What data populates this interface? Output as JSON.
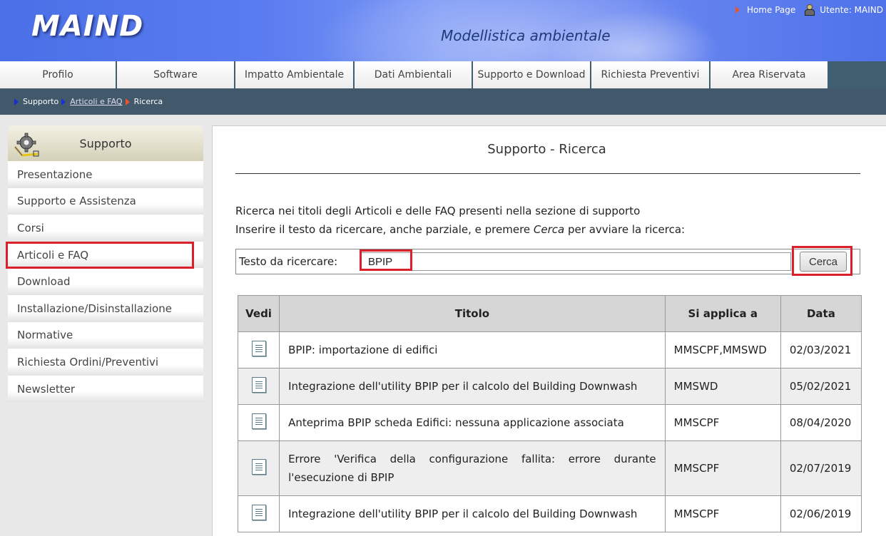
{
  "header": {
    "logo": "MAIND",
    "tagline": "Modellistica ambientale",
    "home_link": "Home Page",
    "user_label": "Utente: MAIND"
  },
  "nav": [
    {
      "label": "Profilo"
    },
    {
      "label": "Software"
    },
    {
      "label": "Impatto Ambientale"
    },
    {
      "label": "Dati Ambientali"
    },
    {
      "label": "Supporto e Download"
    },
    {
      "label": "Richiesta Preventivi"
    },
    {
      "label": "Area Riservata"
    }
  ],
  "breadcrumb": {
    "item1": "Supporto",
    "item2": "Articoli e FAQ",
    "item3": "Ricerca"
  },
  "sidebar": {
    "title": "Supporto",
    "items": [
      {
        "label": "Presentazione"
      },
      {
        "label": "Supporto e Assistenza"
      },
      {
        "label": "Corsi"
      },
      {
        "label": "Articoli e FAQ"
      },
      {
        "label": "Download"
      },
      {
        "label": "Installazione/Disinstallazione"
      },
      {
        "label": "Normative"
      },
      {
        "label": "Richiesta Ordini/Preventivi"
      },
      {
        "label": "Newsletter"
      }
    ]
  },
  "main": {
    "title": "Supporto - Ricerca",
    "intro_line1": "Ricerca nei titoli degli Articoli e delle FAQ presenti nella sezione di supporto",
    "intro_line2_pre": "Inserire il testo da ricercare, anche parziale, e premere ",
    "intro_line2_em": "Cerca",
    "intro_line2_post": " per avviare la ricerca:",
    "search_label": "Testo da ricercare:",
    "search_value": "BPIP",
    "search_button": "Cerca"
  },
  "table": {
    "headers": {
      "vedi": "Vedi",
      "titolo": "Titolo",
      "applica": "Si applica a",
      "data": "Data"
    },
    "rows": [
      {
        "titolo": "BPIP: importazione di edifici",
        "applica": "MMSCPF,MMSWD",
        "data": "02/03/2021"
      },
      {
        "titolo": "Integrazione dell'utility BPIP per il calcolo del Building Downwash",
        "applica": "MMSWD",
        "data": "05/02/2021"
      },
      {
        "titolo": "Anteprima BPIP scheda Edifici: nessuna applicazione associata",
        "applica": "MMSCPF",
        "data": "08/04/2020"
      },
      {
        "titolo": "Errore 'Verifica della configurazione fallita: errore durante l'esecuzione di BPIP",
        "applica": "MMSCPF",
        "data": "02/07/2019"
      },
      {
        "titolo": "Integrazione dell'utility BPIP per il calcolo del Building Downwash",
        "applica": "MMSCPF",
        "data": "02/06/2019"
      }
    ]
  },
  "colors": {
    "highlight": "#d9202b",
    "nav_bg": "#3f5e6f",
    "header_blue": "#5a7cf0"
  }
}
